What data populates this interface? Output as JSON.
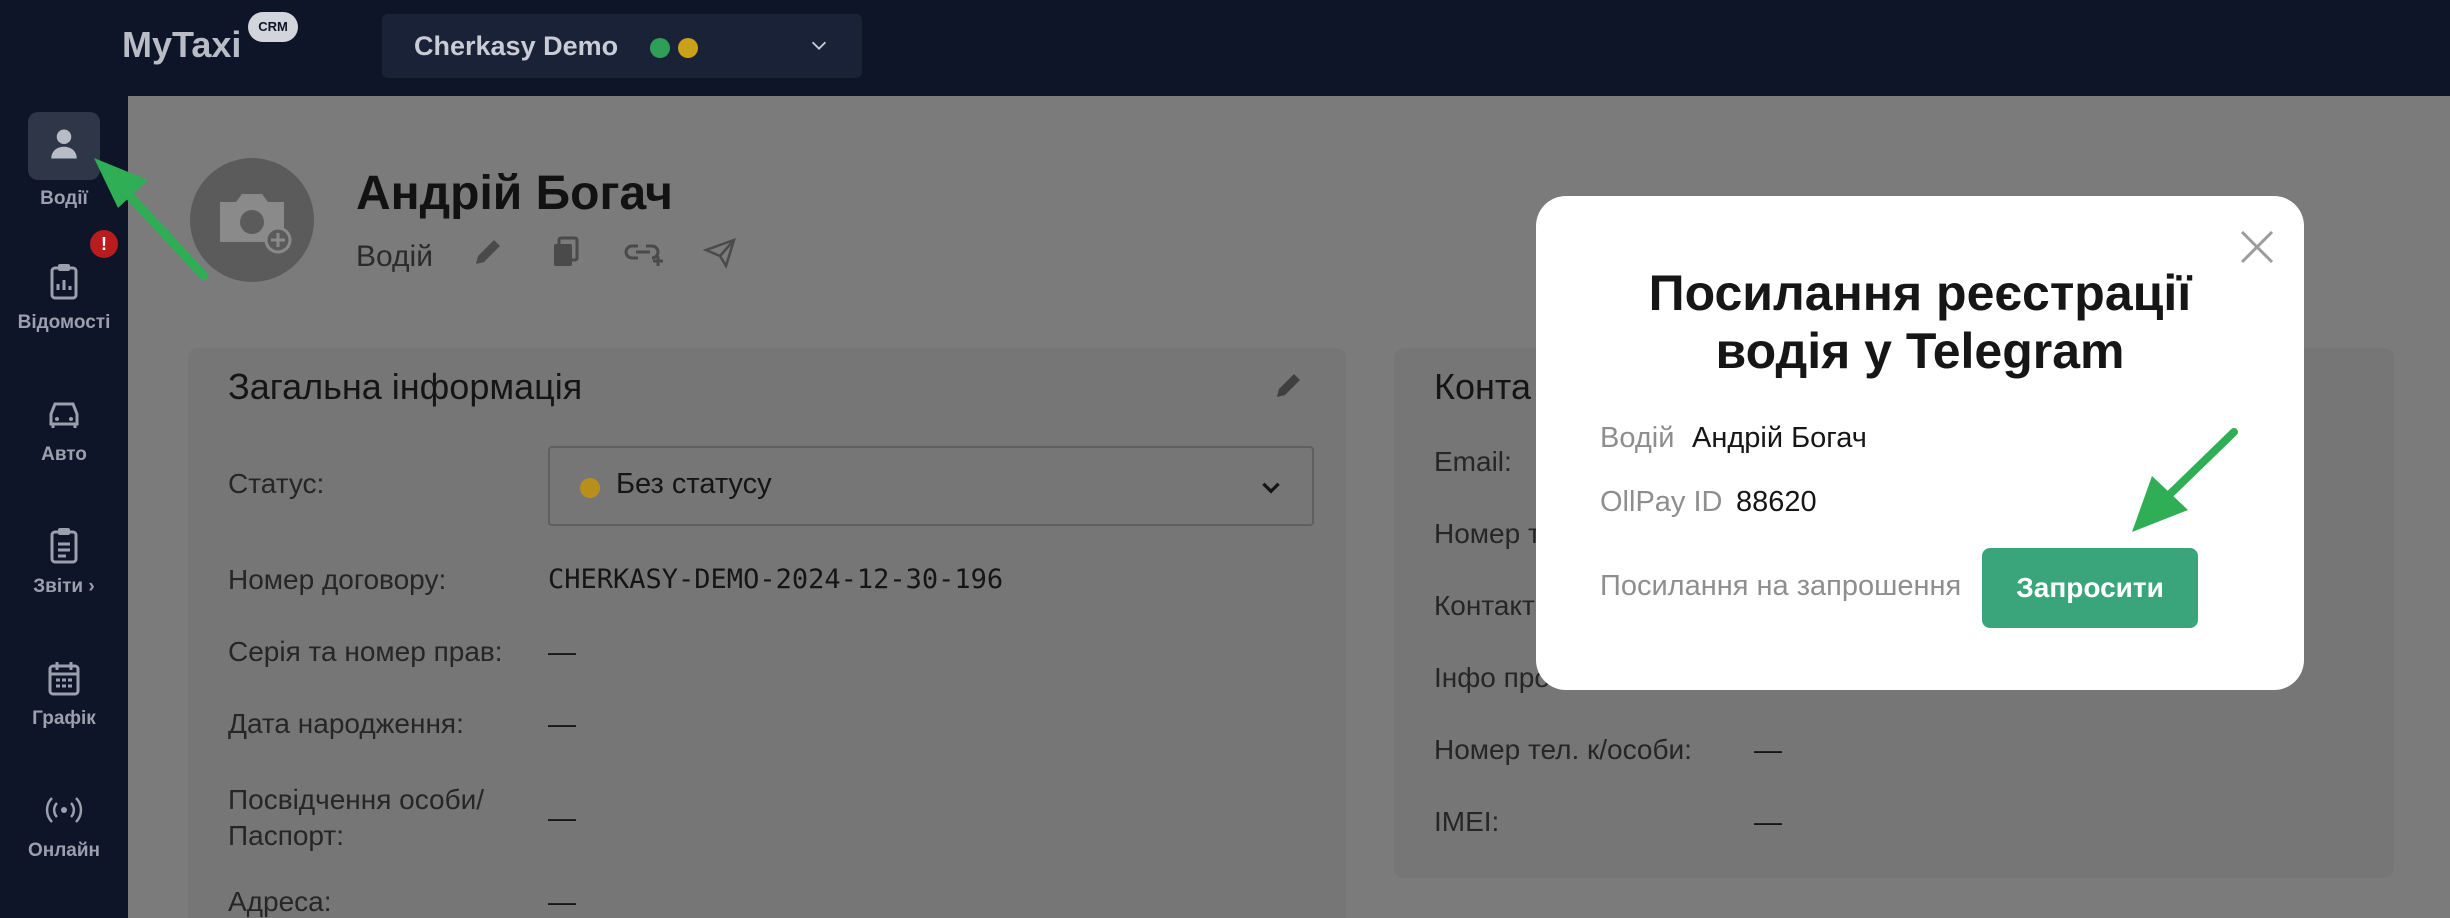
{
  "header": {
    "logo": "MyTaxi",
    "badge": "CRM",
    "company": "Cherkasy Demo"
  },
  "sidebar": {
    "alert": "!",
    "items": [
      {
        "label": "Водії",
        "icon": "user-icon"
      },
      {
        "label": "Відомості",
        "icon": "clipboard-icon"
      },
      {
        "label": "Авто",
        "icon": "car-icon"
      },
      {
        "label": "Звіти ›",
        "icon": "report-icon"
      },
      {
        "label": "Графік",
        "icon": "calendar-icon"
      },
      {
        "label": "Онлайн",
        "icon": "broadcast-icon"
      }
    ]
  },
  "profile": {
    "name": "Андрій Богач",
    "role": "Водій"
  },
  "general": {
    "title": "Загальна інформація",
    "status_label": "Статус:",
    "status_value": "Без статусу",
    "rows": [
      {
        "label": "Номер договору:",
        "value": "CHERKASY-DEMO-2024-12-30-196"
      },
      {
        "label": "Серія та номер прав:",
        "value": "—"
      },
      {
        "label": "Дата народження:",
        "value": "—"
      },
      {
        "label": "Посвідчення особи/ Паспорт:",
        "value": "—"
      },
      {
        "label": "Адреса:",
        "value": "—"
      }
    ]
  },
  "contacts": {
    "title": "Конта",
    "rows": [
      {
        "label": "Email:",
        "value": ""
      },
      {
        "label": "Номер т",
        "value": ""
      },
      {
        "label": "Контакт",
        "value": ""
      },
      {
        "label": "Інфо про",
        "value": ""
      },
      {
        "label": "Номер тел. к/особи:",
        "value": "—"
      },
      {
        "label": "IMEI:",
        "value": "—"
      }
    ]
  },
  "modal": {
    "title": "Посилання реєстрації водія у Telegram",
    "driver_label": "Водій",
    "driver_value": "Андрій Богач",
    "id_label": "OllPay ID",
    "id_value": "88620",
    "link_label": "Посилання на запрошення",
    "invite_button": "Запросити"
  },
  "colors": {
    "topbar": "#0f1528",
    "accent_green": "#3aa57a",
    "arrow_green": "#2fae56"
  }
}
